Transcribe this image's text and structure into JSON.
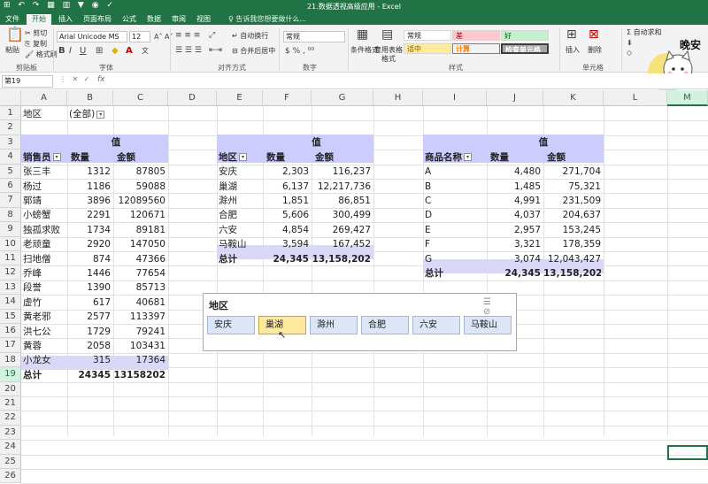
{
  "window": {
    "title": "21.数据透视高级应用 - Excel",
    "qat_icons": "⊞ ↶ ↷ ▦ ▥ ▼ ◉ ✓"
  },
  "tabs": [
    "文件",
    "开始",
    "插入",
    "页面布局",
    "公式",
    "数据",
    "审阅",
    "视图"
  ],
  "active_tab": "开始",
  "tell_me": "告诉我您想要做什么...",
  "ribbon": {
    "clipboard": {
      "paste": "粘贴",
      "cut": "剪切",
      "copy": "复制",
      "format_painter": "格式刷",
      "label": "剪贴板"
    },
    "font": {
      "name": "Arial Unicode MS",
      "size": "12",
      "label": "字体"
    },
    "alignment": {
      "wrap": "自动换行",
      "merge": "合并后居中",
      "label": "对齐方式"
    },
    "number": {
      "format": "常规",
      "label": "数字"
    },
    "styles": {
      "conditional": "条件格式",
      "table": "套用表格格式",
      "normal": "常规",
      "bad": "差",
      "good": "好",
      "neutral": "适中",
      "calc": "计算",
      "check": "检查单元格",
      "label": "样式"
    },
    "cells": {
      "insert": "插入",
      "delete": "删除",
      "label": "单元格"
    },
    "editing": {
      "autosum": "自动求和"
    }
  },
  "avatar_text": "晚安",
  "name_box": "第19",
  "formula_fx": "fx",
  "columns": [
    "A",
    "B",
    "C",
    "D",
    "E",
    "F",
    "G",
    "H",
    "I",
    "J",
    "K",
    "L",
    "M"
  ],
  "selected_column": "M",
  "rows": [
    "1",
    "2",
    "3",
    "4",
    "5",
    "6",
    "7",
    "8",
    "9",
    "10",
    "11",
    "12",
    "13",
    "14",
    "15",
    "16",
    "17",
    "18",
    "19",
    "20",
    "21",
    "22",
    "23",
    "24",
    "25",
    "26"
  ],
  "selected_row": "19",
  "filter": {
    "label": "地区",
    "value": "(全部)",
    "dd": "▾"
  },
  "pivot1": {
    "value_header": "值",
    "row_label": "销售员",
    "col1": "数量",
    "col2": "金额",
    "dd": "▾",
    "rows": [
      [
        "张三丰",
        "1312",
        "87805"
      ],
      [
        "杨过",
        "1186",
        "59088"
      ],
      [
        "郭靖",
        "3896",
        "12089560"
      ],
      [
        "小螃蟹",
        "2291",
        "120671"
      ],
      [
        "独孤求败",
        "1734",
        "89181"
      ],
      [
        "老顽童",
        "2920",
        "147050"
      ],
      [
        "扫地僧",
        "874",
        "47366"
      ],
      [
        "乔峰",
        "1446",
        "77654"
      ],
      [
        "段誉",
        "1390",
        "85713"
      ],
      [
        "虚竹",
        "617",
        "40681"
      ],
      [
        "黄老邪",
        "2577",
        "113397"
      ],
      [
        "洪七公",
        "1729",
        "79241"
      ],
      [
        "黄蓉",
        "2058",
        "103431"
      ],
      [
        "小龙女",
        "315",
        "17364"
      ]
    ],
    "total": [
      "总计",
      "24345",
      "13158202"
    ]
  },
  "pivot2": {
    "value_header": "值",
    "row_label": "地区",
    "col1": "数量",
    "col2": "金额",
    "dd": "▾",
    "rows": [
      [
        "安庆",
        "2,303",
        "116,237"
      ],
      [
        "巢湖",
        "6,137",
        "12,217,736"
      ],
      [
        "滁州",
        "1,851",
        "86,851"
      ],
      [
        "合肥",
        "5,606",
        "300,499"
      ],
      [
        "六安",
        "4,854",
        "269,427"
      ],
      [
        "马鞍山",
        "3,594",
        "167,452"
      ]
    ],
    "total": [
      "总计",
      "24,345",
      "13,158,202"
    ]
  },
  "pivot3": {
    "value_header": "值",
    "row_label": "商品名称",
    "col1": "数量",
    "col2": "金额",
    "dd": "▾",
    "rows": [
      [
        "A",
        "4,480",
        "271,704"
      ],
      [
        "B",
        "1,485",
        "75,321"
      ],
      [
        "C",
        "4,991",
        "231,509"
      ],
      [
        "D",
        "4,037",
        "204,637"
      ],
      [
        "E",
        "2,957",
        "153,245"
      ],
      [
        "F",
        "3,321",
        "178,359"
      ],
      [
        "G",
        "3,074",
        "12,043,427"
      ]
    ],
    "total": [
      "总计",
      "24,345",
      "13,158,202"
    ]
  },
  "slicer": {
    "title": "地区",
    "icons": "☰ ⊘",
    "items": [
      "安庆",
      "巢湖",
      "滁州",
      "合肥",
      "六安",
      "马鞍山"
    ],
    "selected": "巢湖"
  },
  "cursor_glyph": "↖"
}
